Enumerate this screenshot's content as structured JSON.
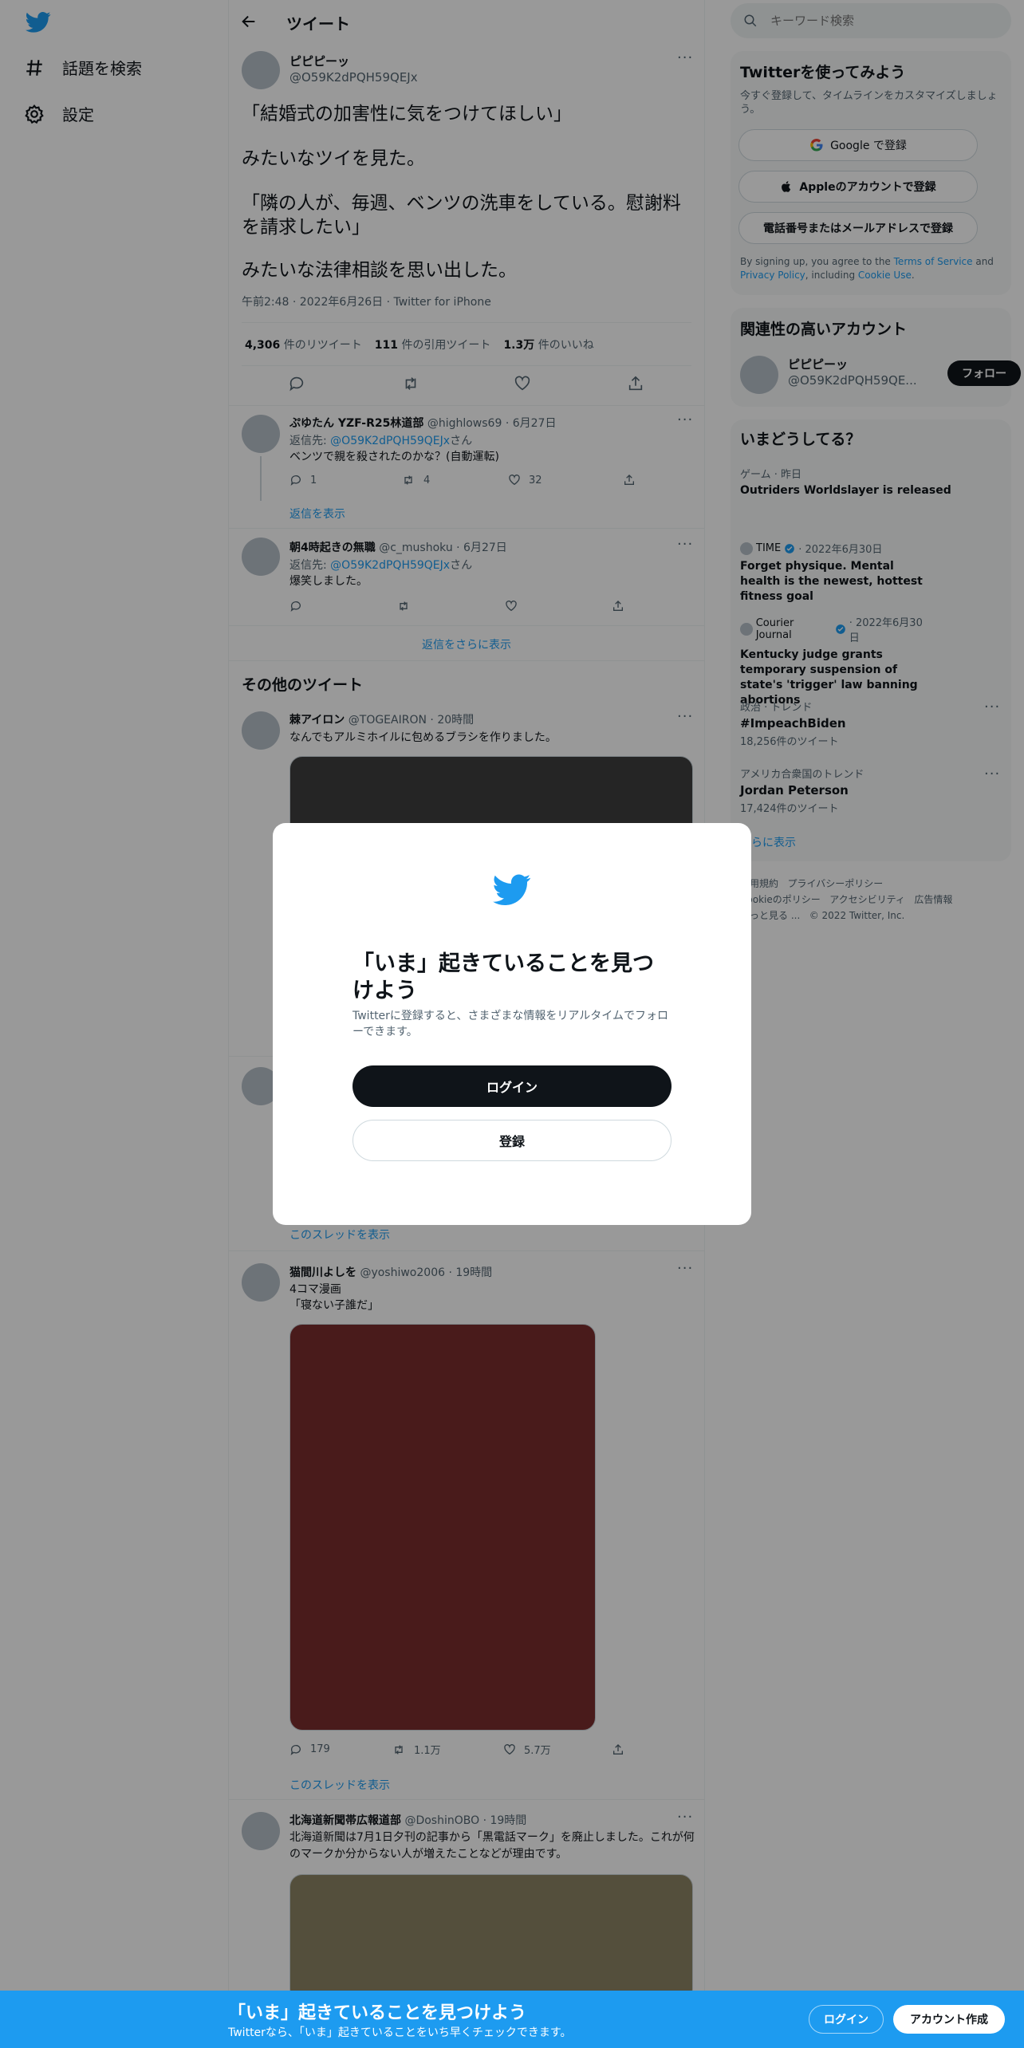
{
  "colors": {
    "accent": "#1d9bf0",
    "text": "#0f1419",
    "muted": "#536471",
    "overlay": "rgba(0,0,0,0.4)",
    "media_dark": "#3f3f3f",
    "media_red": "#7a2e2e",
    "media_olive": "#8c8465"
  },
  "nav": {
    "logo": "twitter-bird-icon",
    "items": [
      {
        "icon": "hash-icon",
        "label": "話題を検索"
      },
      {
        "icon": "gear-icon",
        "label": "設定"
      }
    ]
  },
  "header": {
    "title": "ツイート"
  },
  "main_tweet": {
    "name": "ピピピーッ",
    "handle": "@O59K2dPQH59QEJx",
    "lines": [
      "「結婚式の加害性に気をつけてほしい」",
      "みたいなツイを見た。",
      "「隣の人が、毎週、ベンツの洗車をしている。慰謝料を請求したい」",
      "みたいな法律相談を思い出した。"
    ],
    "meta": "午前2:48 · 2022年6月26日 · Twitter for iPhone",
    "stats": [
      {
        "value": "4,306",
        "label": "件のリツイート"
      },
      {
        "value": "111",
        "label": "件の引用ツイート"
      },
      {
        "value": "1.3万",
        "label": "件のいいね"
      }
    ]
  },
  "replies": [
    {
      "name": "ぷゆたん YZF-R25林道部",
      "handle": "@highlows69",
      "date": "· 6月27日",
      "reply_prefix": "返信先: ",
      "reply_to": "@O59K2dPQH59QEJx",
      "reply_suffix": "さん",
      "text": "ベンツで親を殺されたのかな？(自動運転)",
      "counts": {
        "reply": "1",
        "retweet": "4",
        "like": "32"
      },
      "show_replies": "返信を表示"
    },
    {
      "name": "朝4時起きの無職",
      "handle": "@c_mushoku",
      "date": "· 6月27日",
      "reply_prefix": "返信先: ",
      "reply_to": "@O59K2dPQH59QEJx",
      "reply_suffix": "さん",
      "text": "爆笑しました。"
    }
  ],
  "show_more_replies": "返信をさらに表示",
  "other_tweets_heading": "その他のツイート",
  "other_tweets": [
    {
      "name": "棘アイロン",
      "handle": "@TOGEAIRON",
      "date": "· 20時間",
      "text": "なんでもアルミホイルに包めるブラシを作りました。"
    },
    {
      "show_thread": "このスレッドを表示"
    },
    {
      "name": "猫間川よしを",
      "handle": "@yoshiwo2006",
      "date": "· 19時間",
      "text1": "4コマ漫画",
      "text2": "「寝ない子誰だ」",
      "counts": {
        "reply": "179",
        "retweet": "1.1万",
        "like": "5.7万"
      },
      "show_thread": "このスレッドを表示"
    },
    {
      "name": "北海道新聞帯広報道部",
      "handle": "@DoshinOBO",
      "date": "· 19時間",
      "text": "北海道新聞は7月1日夕刊の記事から「黒電話マーク」を廃止しました。これが何のマークか分からない人が増えたことなどが理由です。"
    }
  ],
  "search": {
    "placeholder": "キーワード検索"
  },
  "signup": {
    "title": "Twitterを使ってみよう",
    "subtitle": "今すぐ登録して、タイムラインをカスタマイズしましょう。",
    "google": "Google で登録",
    "apple": "Appleのアカウントで登録",
    "phone": "電話番号またはメールアドレスで登録",
    "terms_prefix": "By signing up, you agree to the ",
    "terms_link": "Terms of Service",
    "terms_and": " and ",
    "privacy_link": "Privacy Policy",
    "terms_including": ", including ",
    "cookie_link": "Cookie Use",
    "terms_end": "."
  },
  "related": {
    "title": "関連性の高いアカウント",
    "name": "ピピピーッ",
    "handle": "@O59K2dPQH59QE...",
    "follow": "フォロー"
  },
  "trends": {
    "title": "いまどうしてる？",
    "items": [
      {
        "meta": "ゲーム · 昨日",
        "title": "Outriders Worldslayer is released"
      },
      {
        "source": "TIME",
        "date": "· 2022年6月30日",
        "title": "Forget physique. Mental health is the newest, hottest fitness goal"
      },
      {
        "source": "Courier Journal",
        "date": "· 2022年6月30日",
        "title": "Kentucky judge grants temporary suspension of state's 'trigger' law banning abortions"
      },
      {
        "meta": "政治 · トレンド",
        "title": "#ImpeachBiden",
        "count": "18,256件のツイート"
      },
      {
        "meta": "アメリカ合衆国のトレンド",
        "title": "Jordan Peterson",
        "count": "17,424件のツイート"
      }
    ],
    "show_more": "さらに表示"
  },
  "footer": {
    "links": [
      "利用規約",
      "プライバシーポリシー",
      "Cookieのポリシー",
      "アクセシビリティ",
      "広告情報",
      "もっと見る ...",
      "© 2022 Twitter, Inc."
    ]
  },
  "modal": {
    "title": "「いま」起きていることを見つけよう",
    "subtitle": "Twitterに登録すると、さまざまな情報をリアルタイムでフォローできます。",
    "login": "ログイン",
    "signup": "登録"
  },
  "bottom_bar": {
    "title": "「いま」起きていることを見つけよう",
    "subtitle": "Twitterなら、「いま」起きていることをいち早くチェックできます。",
    "login": "ログイン",
    "signup": "アカウント作成"
  }
}
